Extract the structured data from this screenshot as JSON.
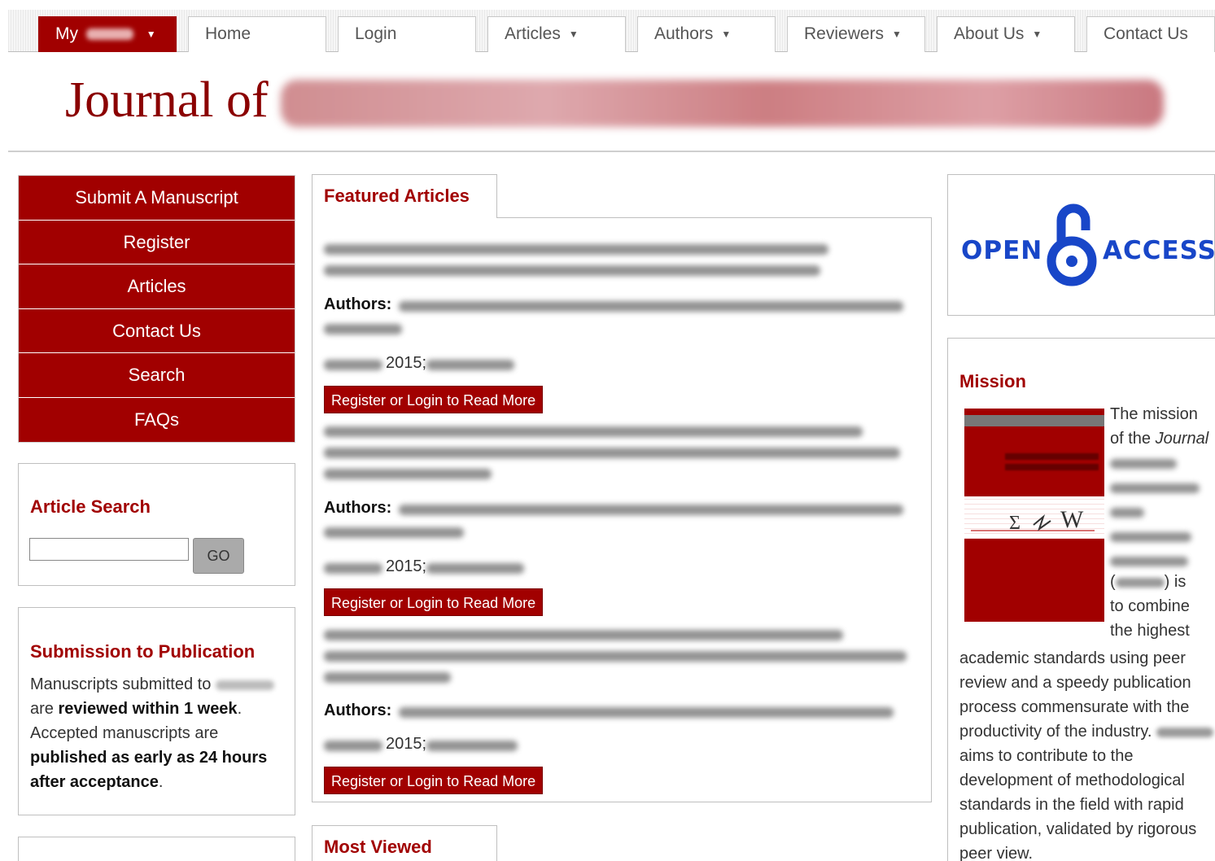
{
  "nav": {
    "my_label": "My",
    "tabs": [
      {
        "label": "Home",
        "dropdown": false
      },
      {
        "label": "Login",
        "dropdown": false
      },
      {
        "label": "Articles",
        "dropdown": true
      },
      {
        "label": "Authors",
        "dropdown": true
      },
      {
        "label": "Reviewers",
        "dropdown": true
      },
      {
        "label": "About Us",
        "dropdown": true
      },
      {
        "label": "Contact Us",
        "dropdown": false
      }
    ],
    "caret": "▼"
  },
  "header": {
    "title_prefix": "Journal of"
  },
  "sidebar": {
    "menu": [
      "Submit A Manuscript",
      "Register",
      "Articles",
      "Contact Us",
      "Search",
      "FAQs"
    ],
    "article_search": {
      "title": "Article Search",
      "go_label": "GO",
      "value": ""
    },
    "submission": {
      "title": "Submission to Publication",
      "line1": "Manuscripts submitted to",
      "line2_pre": "are ",
      "line2_bold": "reviewed within 1 week",
      "line2_post": ".",
      "line3": "Accepted manuscripts are",
      "line4_bold": "published as early as 24 hours after acceptance",
      "line4_post": "."
    }
  },
  "featured": {
    "title": "Featured Articles",
    "authors_label": "Authors:",
    "read_more": "Register or Login to Read More",
    "articles": [
      {
        "cite": "2015;"
      },
      {
        "cite": "2015;"
      },
      {
        "cite": "2015;"
      }
    ]
  },
  "most_viewed": {
    "title": "Most Viewed"
  },
  "open_access": {
    "open": "OPEN",
    "access": "ACCESS"
  },
  "mission": {
    "title": "Mission",
    "wrap_lines": [
      "The mission",
      "of the"
    ],
    "journal_word": "Journal",
    "is_suffix": ") is",
    "wrap_lines2": [
      "to combine",
      "the highest"
    ],
    "text": "academic standards using peer review and a speedy publication process commensurate with the productivity of the industry.",
    "text2": "aims to contribute to the development of methodological standards in the field with rapid publication, validated by rigorous peer view.",
    "open_paren": "("
  },
  "colors": {
    "brand": "#a10000",
    "oa_blue": "#1846c8"
  }
}
